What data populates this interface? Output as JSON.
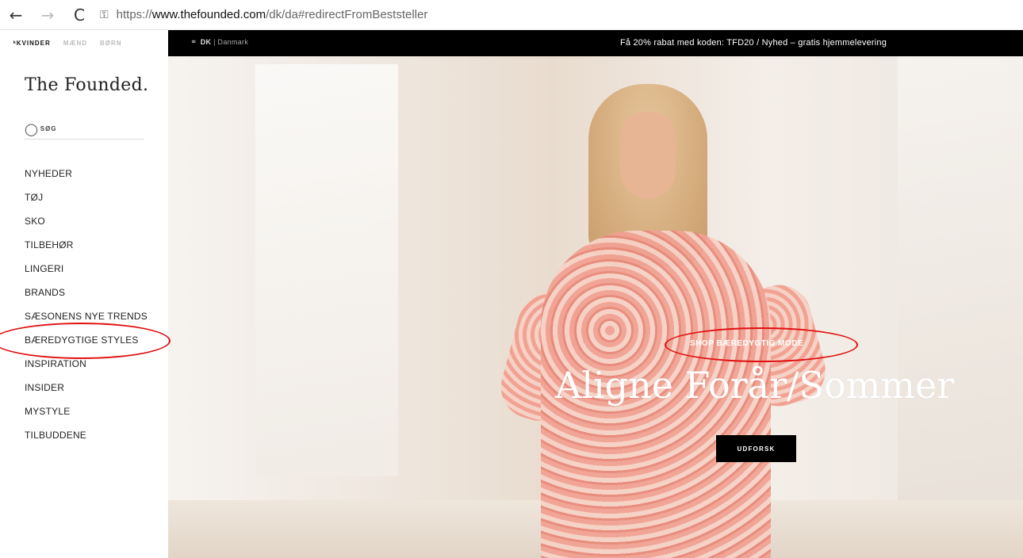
{
  "browser": {
    "back_glyph": "←",
    "forward_glyph": "→",
    "reload_glyph": "C",
    "lock_glyph": "🔒",
    "url_protocol": "https://",
    "url_host": "www.thefounded.com",
    "url_path": "/dk/da#redirectFromBeststeller"
  },
  "gender_tabs": [
    "ᵏKVINDER",
    "MÆND",
    "BØRN"
  ],
  "brand": "The Founded.",
  "search": {
    "icon": "search-icon",
    "placeholder": "søg"
  },
  "menu": [
    "NYHEDER",
    "TØJ",
    "SKO",
    "TILBEHØR",
    "LINGERI",
    "BRANDS",
    "SÆSONENS NYE TRENDS",
    "BÆREDYGTIGE STYLES",
    "INSPIRATION",
    "INSIDER",
    "MYSTYLE",
    "TILBUDDENE"
  ],
  "promo": {
    "globe_glyph": "🌐",
    "country_code": "DK",
    "separator": " | ",
    "country_name": "Danmark",
    "message": "Få 20% rabat med koden: TFD20 / Nyhed – gratis hjemmelevering"
  },
  "hero": {
    "shop_link": "SHOP BÆREDYGTIG MODE",
    "headline": "Aligne Forår/Sommer",
    "cta": "UDFORSK"
  },
  "colors": {
    "promo_bar": "#000000",
    "annotation": "#e01010",
    "cta_bg": "#000000"
  }
}
